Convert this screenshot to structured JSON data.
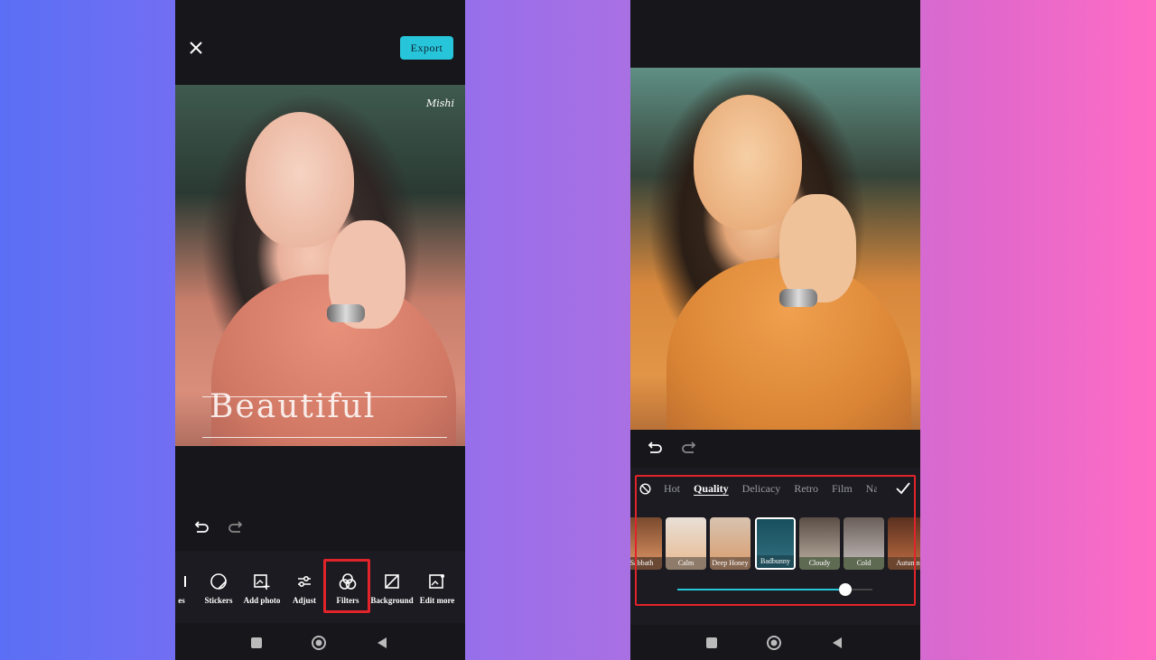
{
  "left_screen": {
    "export_label": "Export",
    "watermark_signature": "Mishi",
    "watermark_title": "Beautiful",
    "tools": [
      {
        "label": "es",
        "icon": "text-icon"
      },
      {
        "label": "Stickers",
        "icon": "sticker-icon"
      },
      {
        "label": "Add photo",
        "icon": "add-photo-icon"
      },
      {
        "label": "Adjust",
        "icon": "sliders-icon"
      },
      {
        "label": "Filters",
        "icon": "filters-icon"
      },
      {
        "label": "Background",
        "icon": "background-icon"
      },
      {
        "label": "Edit more",
        "icon": "edit-more-icon"
      }
    ],
    "highlight_color": "#e0242a"
  },
  "right_screen": {
    "categories": [
      "Hot",
      "Quality",
      "Delicacy",
      "Retro",
      "Film",
      "Na"
    ],
    "active_category": "Quality",
    "filters": [
      {
        "label": "Sabbath",
        "tone": "#c98458"
      },
      {
        "label": "Calm",
        "tone": "#e8c2a0"
      },
      {
        "label": "Deep Honey",
        "tone": "#d9a57c"
      },
      {
        "label": "Badbunny",
        "tone": "#2e6a7a",
        "selected": true
      },
      {
        "label": "Cloudy",
        "tone": "#a89c8f"
      },
      {
        "label": "Cold",
        "tone": "#b0a9a6"
      },
      {
        "label": "Autumn",
        "tone": "#a85f3a"
      }
    ],
    "intensity": 0.86,
    "accent_color": "#27c5d9"
  },
  "background_gradient": [
    "#5a6ff5",
    "#ff6cc4"
  ]
}
